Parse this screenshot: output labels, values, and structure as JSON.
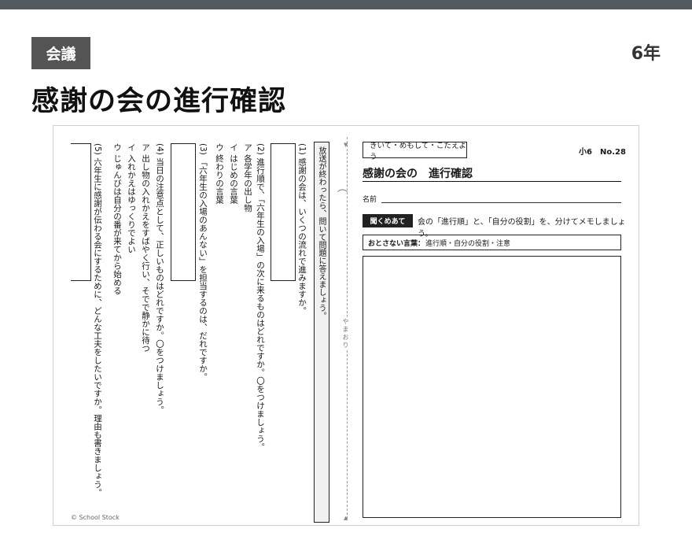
{
  "header": {
    "category": "会議",
    "grade": "6年",
    "title": "感謝の会の進行確認"
  },
  "left_page": {
    "q1": "(1) 感謝の会は、いくつの流れで進みますか。",
    "q2": "(2) 進行順で、「六年生の入場」の次に来るものはどれですか。〇をつけましょう。",
    "q2_opt_a": "ア 各学年の出し物",
    "q2_opt_i": "イ はじめの言葉",
    "q2_opt_u": "ウ 終わりの言葉",
    "q3": "(3) 「六年生の入場のあんない」を担当するのは、だれですか。",
    "q4": "(4) 当日の注意点として、正しいものはどれですか。〇をつけましょう。",
    "q4_opt_a": "ア 出し物の入れかえをすばやく行い、そでで静かに待つ",
    "q4_opt_i": "イ 入れかえはゆっくりでよい",
    "q4_opt_u": "ウ じゅんびは自分の番が来てから始める",
    "q5": "(5) 六年生に感謝が伝わる会にするために、どんな工夫をしたいですか。理由も書きましょう。",
    "copyright": "© School Stock"
  },
  "fold": {
    "label": "やまおり",
    "instruction": "放送が終わったら、問いて問題に答えましょう。"
  },
  "right_page": {
    "header_label": "きいて・めもして・こたえよう",
    "number": "小6　No.28",
    "title": "感謝の会の　進行確認",
    "name_label": "名前",
    "task_pill": "聞くめあて",
    "task_text": "会の「進行順」と、「自分の役割」を、分けてメモしましょう。",
    "points_label": "おとさない言葉：",
    "points_text": "進行順・自分の役割・注意"
  },
  "colors": {
    "top_bar": "#555a60",
    "tag_bg": "#545454",
    "card_bg": "#ffffff",
    "page_bg": "#ebebeb"
  }
}
